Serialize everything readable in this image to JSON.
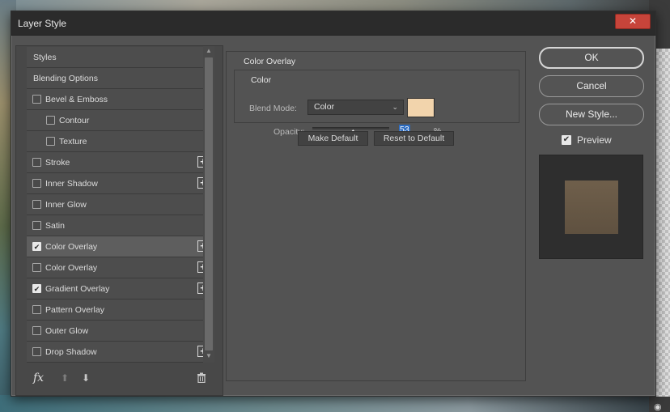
{
  "dialog": {
    "title": "Layer Style",
    "close_glyph": "✕"
  },
  "effects": [
    {
      "label": "Styles",
      "kind": "header",
      "checkbox": false,
      "plus": false
    },
    {
      "label": "Blending Options",
      "kind": "header",
      "checkbox": false,
      "plus": false
    },
    {
      "label": "Bevel & Emboss",
      "kind": "item",
      "checked": false,
      "plus": false
    },
    {
      "label": "Contour",
      "kind": "sub",
      "checked": false,
      "plus": false
    },
    {
      "label": "Texture",
      "kind": "sub",
      "checked": false,
      "plus": false
    },
    {
      "label": "Stroke",
      "kind": "item",
      "checked": false,
      "plus": true
    },
    {
      "label": "Inner Shadow",
      "kind": "item",
      "checked": false,
      "plus": true
    },
    {
      "label": "Inner Glow",
      "kind": "item",
      "checked": false,
      "plus": false
    },
    {
      "label": "Satin",
      "kind": "item",
      "checked": false,
      "plus": false
    },
    {
      "label": "Color Overlay",
      "kind": "item",
      "checked": true,
      "plus": true,
      "selected": true
    },
    {
      "label": "Color Overlay",
      "kind": "item",
      "checked": false,
      "plus": true
    },
    {
      "label": "Gradient Overlay",
      "kind": "item",
      "checked": true,
      "plus": true
    },
    {
      "label": "Pattern Overlay",
      "kind": "item",
      "checked": false,
      "plus": false
    },
    {
      "label": "Outer Glow",
      "kind": "item",
      "checked": false,
      "plus": false
    },
    {
      "label": "Drop Shadow",
      "kind": "item",
      "checked": false,
      "plus": true
    }
  ],
  "footer_icons": {
    "fx": "fx",
    "up": "⬆",
    "down": "⬇",
    "trash": "🗑"
  },
  "color_overlay": {
    "section_title": "Color Overlay",
    "group_title": "Color",
    "blend_mode_label": "Blend Mode:",
    "blend_mode_value": "Color",
    "swatch_color": "#f2d4ac",
    "opacity_label": "Opacity:",
    "opacity_value": "53",
    "opacity_fraction": 0.53,
    "opacity_unit": "%",
    "make_default_label": "Make Default",
    "reset_default_label": "Reset to Default"
  },
  "actions": {
    "ok_label": "OK",
    "cancel_label": "Cancel",
    "new_style_label": "New Style...",
    "preview_label": "Preview",
    "preview_checked": true
  }
}
